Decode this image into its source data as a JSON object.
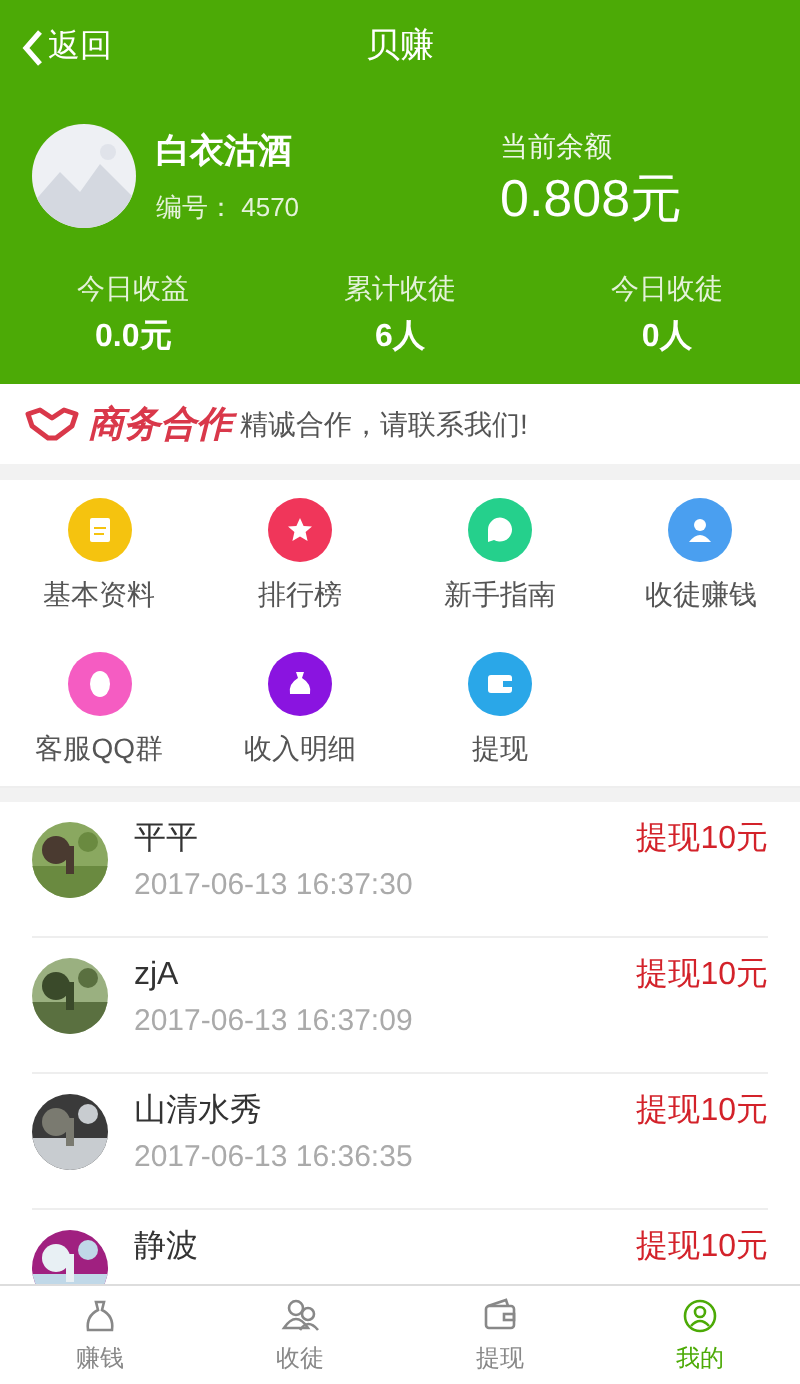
{
  "nav": {
    "back": "返回",
    "title": "贝赚"
  },
  "profile": {
    "name": "白衣沽酒",
    "id_label": "编号：",
    "id": "4570",
    "balance_label": "当前余额",
    "balance": "0.808元"
  },
  "stats": [
    {
      "label": "今日收益",
      "value": "0.0元"
    },
    {
      "label": "累计收徒",
      "value": "6人"
    },
    {
      "label": "今日收徒",
      "value": "0人"
    }
  ],
  "banner": {
    "brand": "商务合作",
    "text": "精诚合作，请联系我们!"
  },
  "menu": [
    {
      "label": "基本资料",
      "kind": "document",
      "color": "#f5c30f"
    },
    {
      "label": "排行榜",
      "kind": "star",
      "color": "#f0365a"
    },
    {
      "label": "新手指南",
      "kind": "question",
      "color": "#25d08c"
    },
    {
      "label": "收徒赚钱",
      "kind": "person",
      "color": "#4a9ff0"
    },
    {
      "label": "客服QQ群",
      "kind": "penguin",
      "color": "#f55cc2"
    },
    {
      "label": "收入明细",
      "kind": "moneybag",
      "color": "#8a14e0"
    },
    {
      "label": "提现",
      "kind": "wallet",
      "color": "#2aa7e8"
    }
  ],
  "records": [
    {
      "name": "平平",
      "time": "2017-06-13 16:37:30",
      "amount": "提现10元"
    },
    {
      "name": "zjA",
      "time": "2017-06-13 16:37:09",
      "amount": "提现10元"
    },
    {
      "name": "山清水秀",
      "time": "2017-06-13 16:36:35",
      "amount": "提现10元"
    },
    {
      "name": "静波",
      "amount": "提现10元"
    }
  ],
  "tabs": [
    {
      "label": "赚钱",
      "kind": "moneybag",
      "selected": false
    },
    {
      "label": "收徒",
      "kind": "people",
      "selected": false
    },
    {
      "label": "提现",
      "kind": "wallet",
      "selected": false
    },
    {
      "label": "我的",
      "kind": "person",
      "selected": true
    }
  ]
}
